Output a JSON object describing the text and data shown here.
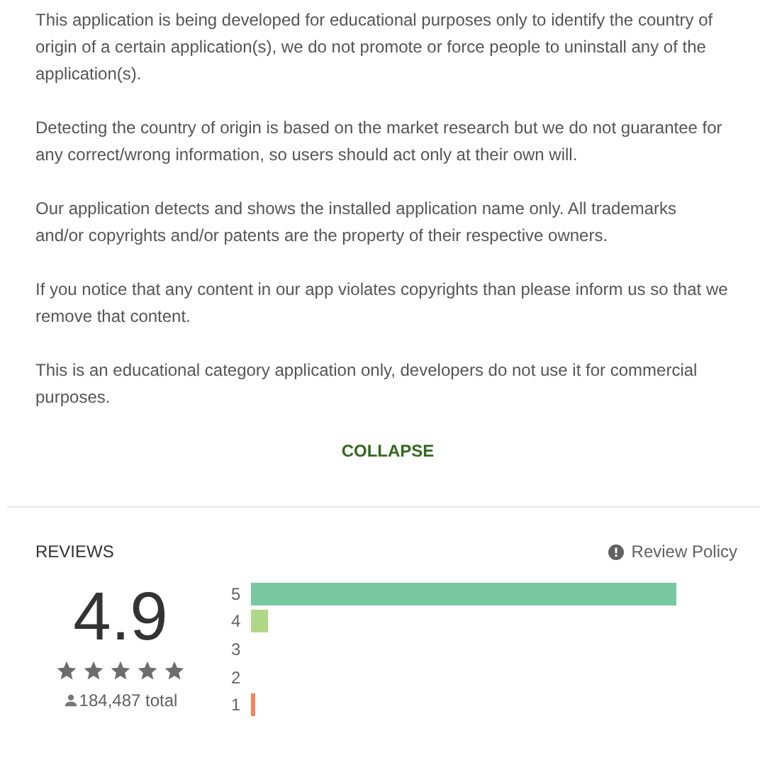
{
  "description": {
    "paragraphs": [
      "This application is being developed for educational purposes only to identify the country of origin of a certain application(s), we do not promote or force people to uninstall any of the application(s).",
      "Detecting the country of origin is based on the market research but we do not guarantee for any correct/wrong information, so users should act only at their own will.",
      "Our application detects and shows the installed application name only. All trademarks and/or copyrights and/or patents are the property of their respective owners.",
      "If you notice that any content in our app violates copyrights than please inform us so that we remove that content.",
      "This is an educational category application only, developers do not use it for commercial purposes."
    ],
    "collapse_button": "COLLAPSE"
  },
  "reviews": {
    "title": "REVIEWS",
    "policy_link": "Review Policy",
    "score": "4.9",
    "stars": 5,
    "total": "184,487 total",
    "histogram": [
      {
        "label": "5",
        "color": "#78c9a1"
      },
      {
        "label": "4",
        "color": "#afd886"
      },
      {
        "label": "3"
      },
      {
        "label": "2"
      },
      {
        "label": "1",
        "color": "#f7855a"
      }
    ]
  }
}
